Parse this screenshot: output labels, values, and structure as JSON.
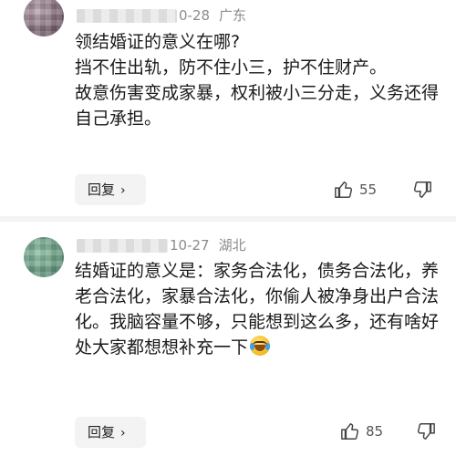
{
  "comments": [
    {
      "date": "0-28",
      "location": "广东",
      "paragraphs": [
        "领结婚证的意义在哪?",
        "挡不住出轨，防不住小三，护不住财产。",
        "故意伤害变成家暴，权利被小三分走，义务还得自己承担。"
      ],
      "reply_label": "回复",
      "reply_chevron": "›",
      "likes": "55",
      "icons": {
        "like": "thumbs-up-icon",
        "dislike": "thumbs-down-icon",
        "reply_arrow": "chevron-right-icon"
      }
    },
    {
      "date": "10-27",
      "location": "湖北",
      "paragraphs": [
        "结婚证的意义是：家务合法化，债务合法化，养老合法化，家暴合法化，你偷人被净身出户合法化。我脑容量不够，只能想到这么多，还有啥好处大家都想想补充一下"
      ],
      "reply_label": "回复",
      "reply_chevron": "›",
      "likes": "85",
      "icons": {
        "like": "thumbs-up-icon",
        "dislike": "thumbs-down-icon",
        "emoji": "crying-laughing-emoji-icon"
      }
    }
  ]
}
